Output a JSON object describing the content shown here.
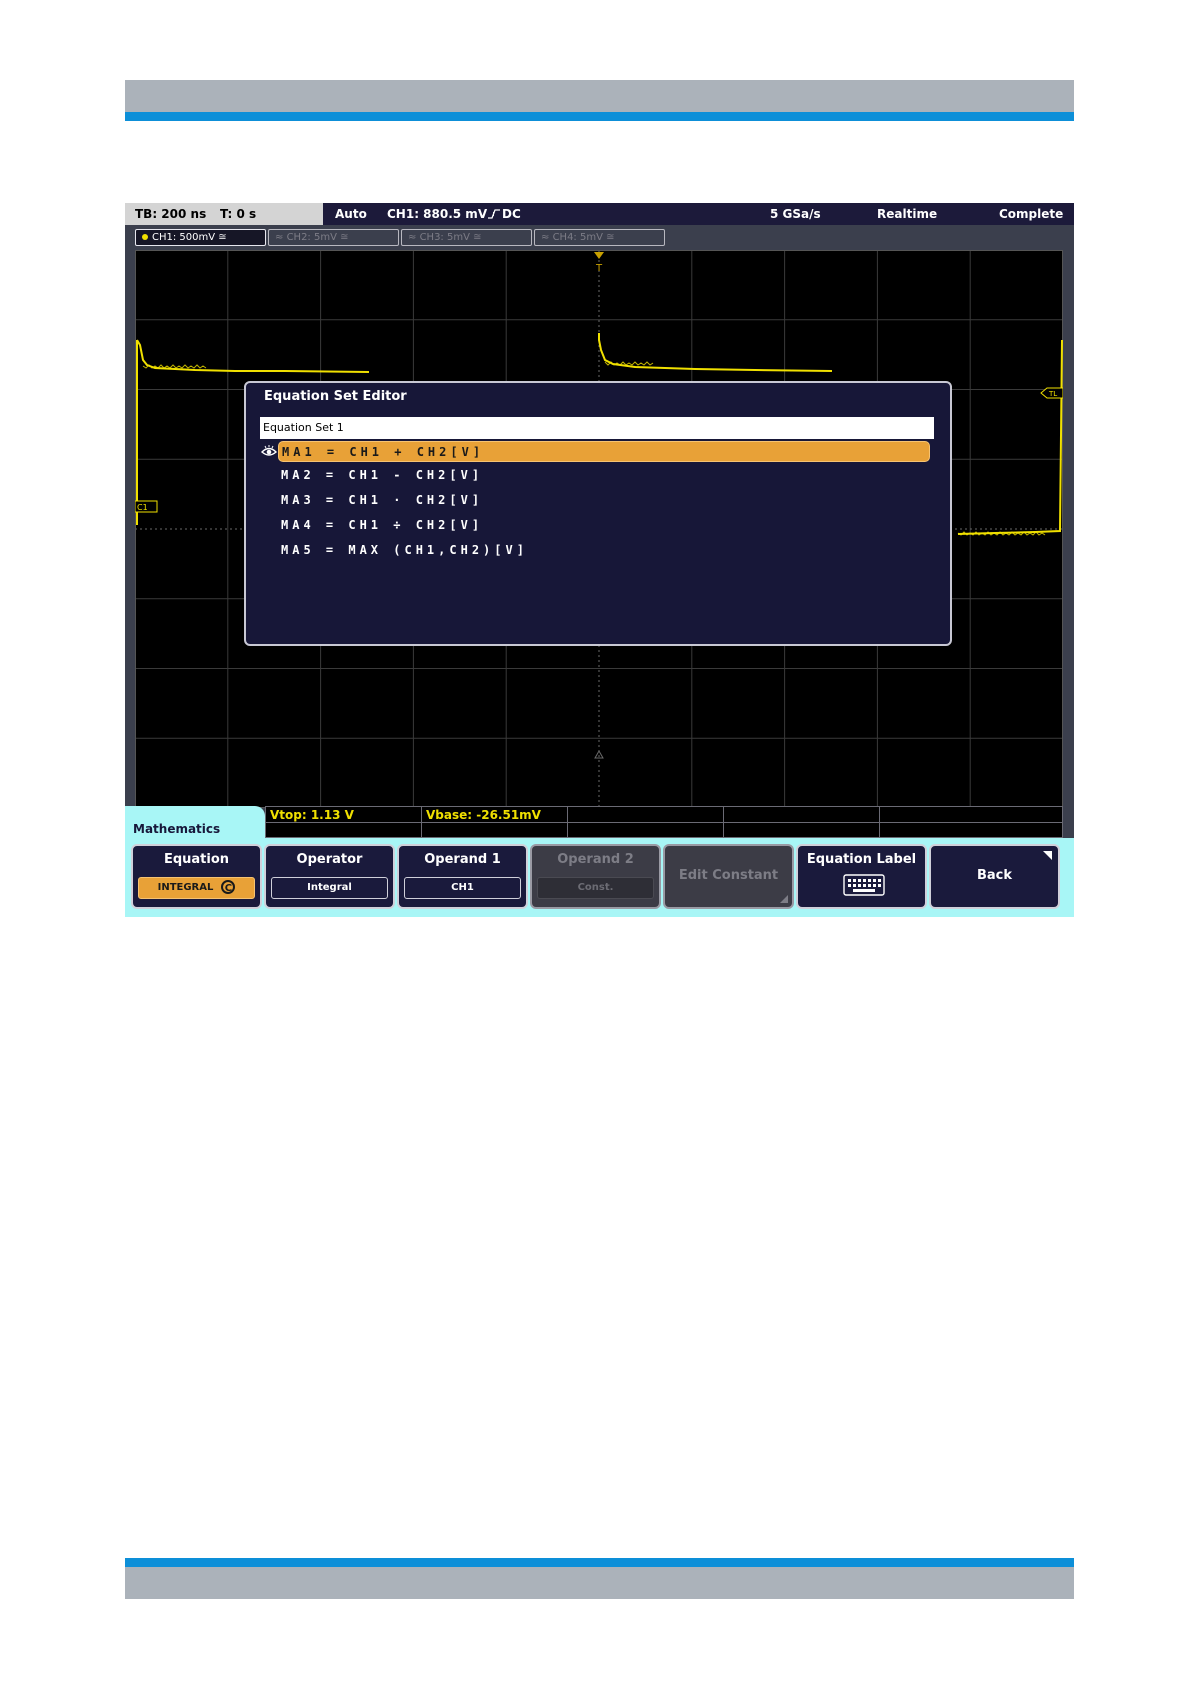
{
  "status": {
    "timebase": "TB: 200 ns",
    "trigger_time": "T: 0 s",
    "mode": "Auto",
    "trigger": "CH1: 880.5 mV",
    "coupling": "DC",
    "sample_rate": "5 GSa/s",
    "acq_mode": "Realtime",
    "acq_state": "Complete"
  },
  "channels": [
    {
      "label": "CH1: 500mV",
      "active": true
    },
    {
      "label": "CH2: 5mV",
      "active": false
    },
    {
      "label": "CH3: 5mV",
      "active": false
    },
    {
      "label": "CH4: 5mV",
      "active": false
    }
  ],
  "markers": {
    "trigger_top": "T",
    "trigger_level": "TL",
    "ch1": "C1"
  },
  "dialog": {
    "title": "Equation Set Editor",
    "set_name": "Equation Set 1",
    "equations": [
      {
        "text": "MA1 = CH1 + CH2[V]",
        "selected": true
      },
      {
        "text": "MA2 = CH1 - CH2[V]",
        "selected": false
      },
      {
        "text": "MA3 = CH1 · CH2[V]",
        "selected": false
      },
      {
        "text": "MA4 = CH1 ÷ CH2[V]",
        "selected": false
      },
      {
        "text": "MA5 = MAX (CH1,CH2)[V]",
        "selected": false
      }
    ]
  },
  "measurements": {
    "vtop": "Vtop: 1.13 V",
    "vbase": "Vbase: -26.51mV"
  },
  "menu": {
    "title": "Mathematics",
    "softkeys": [
      {
        "title": "Equation",
        "value": "INTEGRAL",
        "enabled": true
      },
      {
        "title": "Operator",
        "value": "Integral",
        "enabled": true
      },
      {
        "title": "Operand 1",
        "value": "CH1",
        "enabled": true
      },
      {
        "title": "Operand 2",
        "value": "Const.",
        "enabled": false
      },
      {
        "title": "Edit Constant",
        "enabled": false
      },
      {
        "title": "Equation Label",
        "icon": "keyboard-icon",
        "enabled": true
      },
      {
        "title": "Back",
        "enabled": true
      }
    ]
  },
  "colors": {
    "signal": "#f0e000",
    "highlight": "#e8a137",
    "menu": "#a8f6f6"
  }
}
